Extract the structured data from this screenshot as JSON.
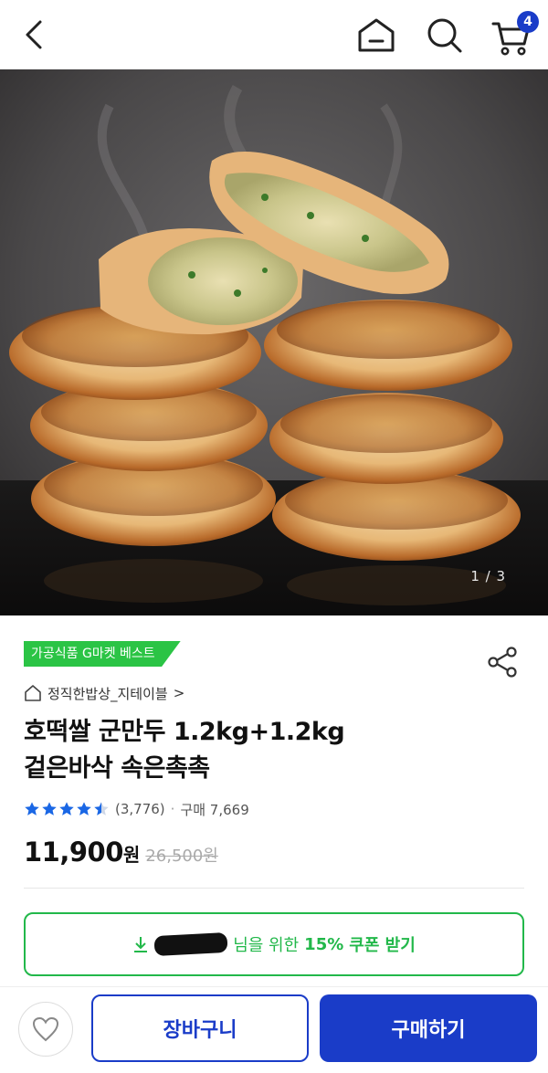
{
  "header": {
    "cart_count": "4",
    "colors": {
      "badge": "#1a3cc8",
      "icon": "#222222"
    },
    "icons": [
      "back-icon",
      "home-icon",
      "search-icon",
      "cart-icon"
    ]
  },
  "gallery": {
    "counter": "1 / 3",
    "image": "product-photo"
  },
  "product": {
    "badge": "가공식품 G마켓 베스트",
    "badge_color": "#2bc445",
    "store": "정직한밥상_지테이블",
    "store_chevron": ">",
    "title_line1": "호떡쌀 군만두 1.2kg+1.2kg",
    "title_line2": "겉은바삭 속은촉촉",
    "rating_value": 4.5,
    "review_count": "(3,776)",
    "purchase_label": "구매 7,669",
    "price": "11,900",
    "price_unit": "원",
    "original_price": "26,500원"
  },
  "coupon": {
    "suffix": "님을 위한",
    "discount": "15%",
    "action": "쿠폰 받기",
    "color": "#22b84a"
  },
  "actions": {
    "cart_label": "장바구니",
    "buy_label": "구매하기",
    "primary_color": "#1a3cc8"
  }
}
